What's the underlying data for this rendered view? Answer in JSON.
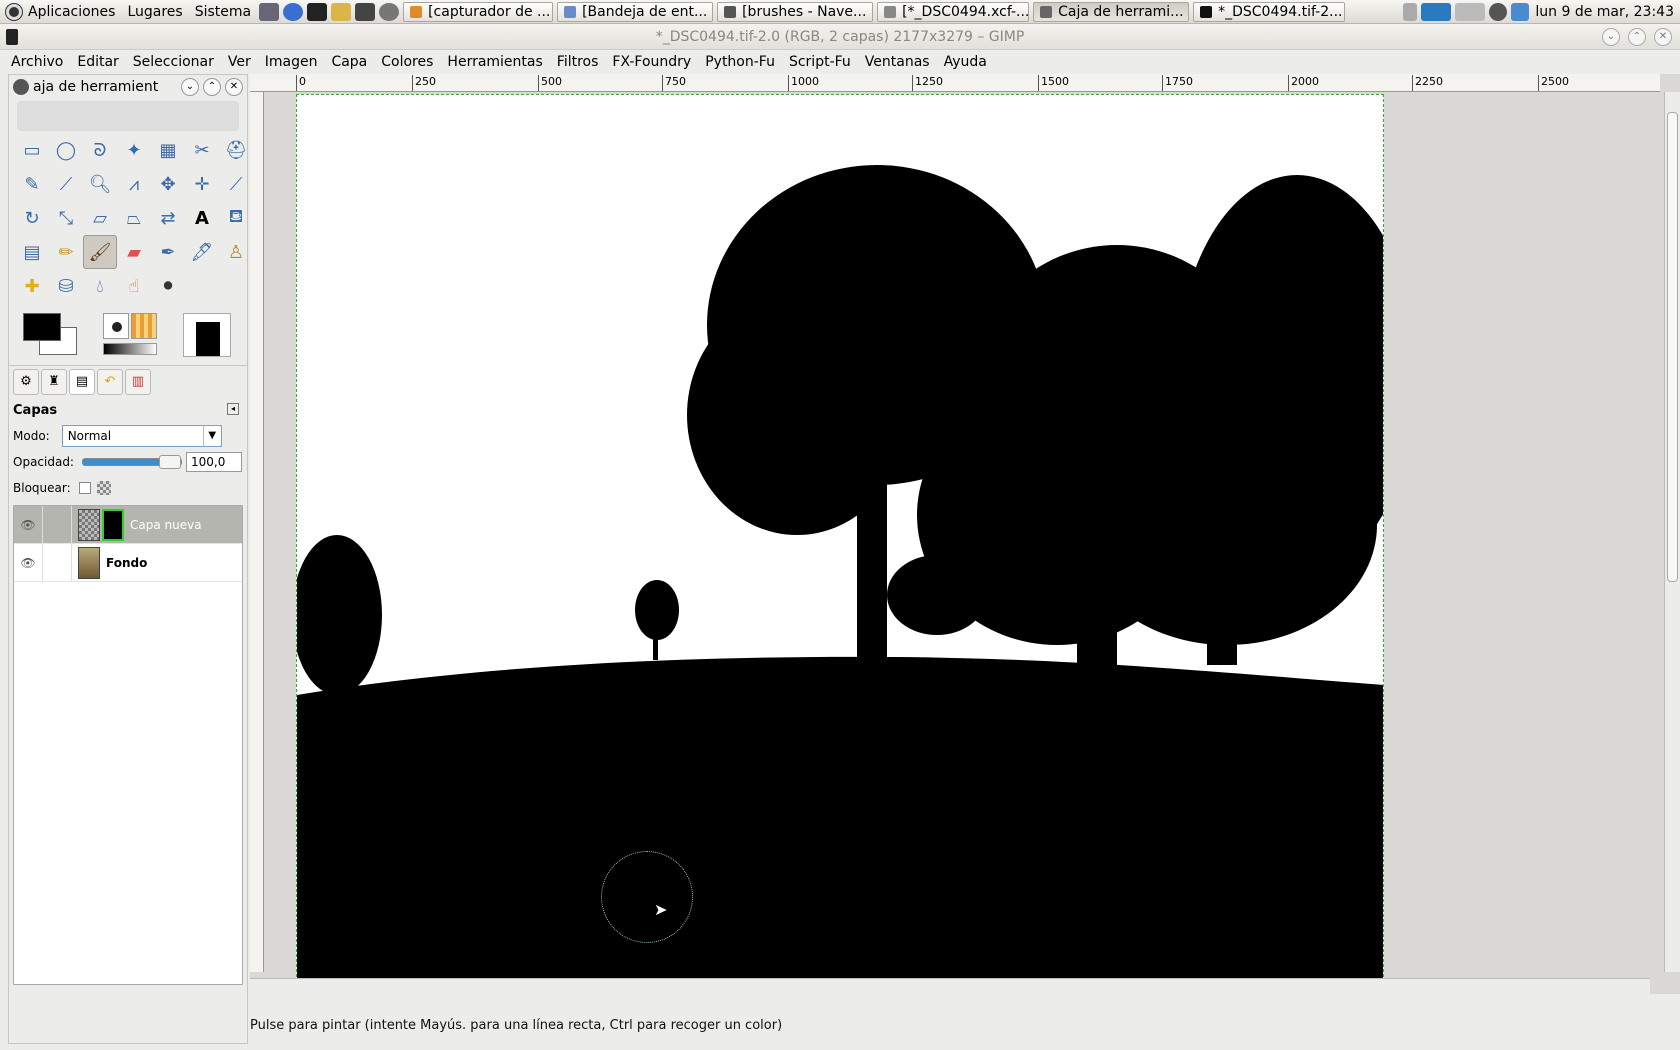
{
  "panel": {
    "menus": [
      "Aplicaciones",
      "Lugares",
      "Sistema"
    ],
    "tasks": [
      {
        "label": "[capturador de ..."
      },
      {
        "label": "[Bandeja de ent..."
      },
      {
        "label": "[brushes - Nave..."
      },
      {
        "label": "[*_DSC0494.xcf-..."
      },
      {
        "label": "Caja de herrami..."
      },
      {
        "label": "*_DSC0494.tif-2..."
      }
    ],
    "clock": "lun  9 de mar, 23:43"
  },
  "window": {
    "title": "*_DSC0494.tif-2.0 (RGB, 2 capas) 2177x3279 – GIMP"
  },
  "menubar": [
    "Archivo",
    "Editar",
    "Seleccionar",
    "Ver",
    "Imagen",
    "Capa",
    "Colores",
    "Herramientas",
    "Filtros",
    "FX-Foundry",
    "Python-Fu",
    "Script-Fu",
    "Ventanas",
    "Ayuda"
  ],
  "toolbox": {
    "title": "aja de herramient",
    "tools": [
      "rect-select",
      "ellipse-select",
      "free-select",
      "fuzzy-select",
      "by-color-select",
      "scissors",
      "foreground-select",
      "paths",
      "color-picker",
      "zoom",
      "measure",
      "move",
      "align",
      "crop",
      "rotate",
      "scale",
      "shear",
      "perspective",
      "flip",
      "text",
      "bucket-fill",
      "blend",
      "pencil",
      "paintbrush",
      "eraser",
      "airbrush",
      "ink",
      "clone",
      "heal",
      "perspective-clone",
      "blur",
      "smudge",
      "dodge-burn"
    ],
    "selected_tool": "paintbrush"
  },
  "layers": {
    "title": "Capas",
    "mode_label": "Modo:",
    "mode": "Normal",
    "opacity_label": "Opacidad:",
    "opacity": "100,0",
    "opacity_value": 1.0,
    "lock_label": "Bloquear:",
    "items": [
      {
        "name": "Capa nueva",
        "selected": true
      },
      {
        "name": "Fondo",
        "selected": false
      }
    ]
  },
  "ruler": {
    "ticks": [
      "0",
      "250",
      "500",
      "750",
      "1000",
      "1250",
      "1500",
      "1750",
      "2000",
      "2250",
      "2500"
    ]
  },
  "status": "Pulse para pintar (intente Mayús. para una línea recta, Ctrl para recoger un color)"
}
